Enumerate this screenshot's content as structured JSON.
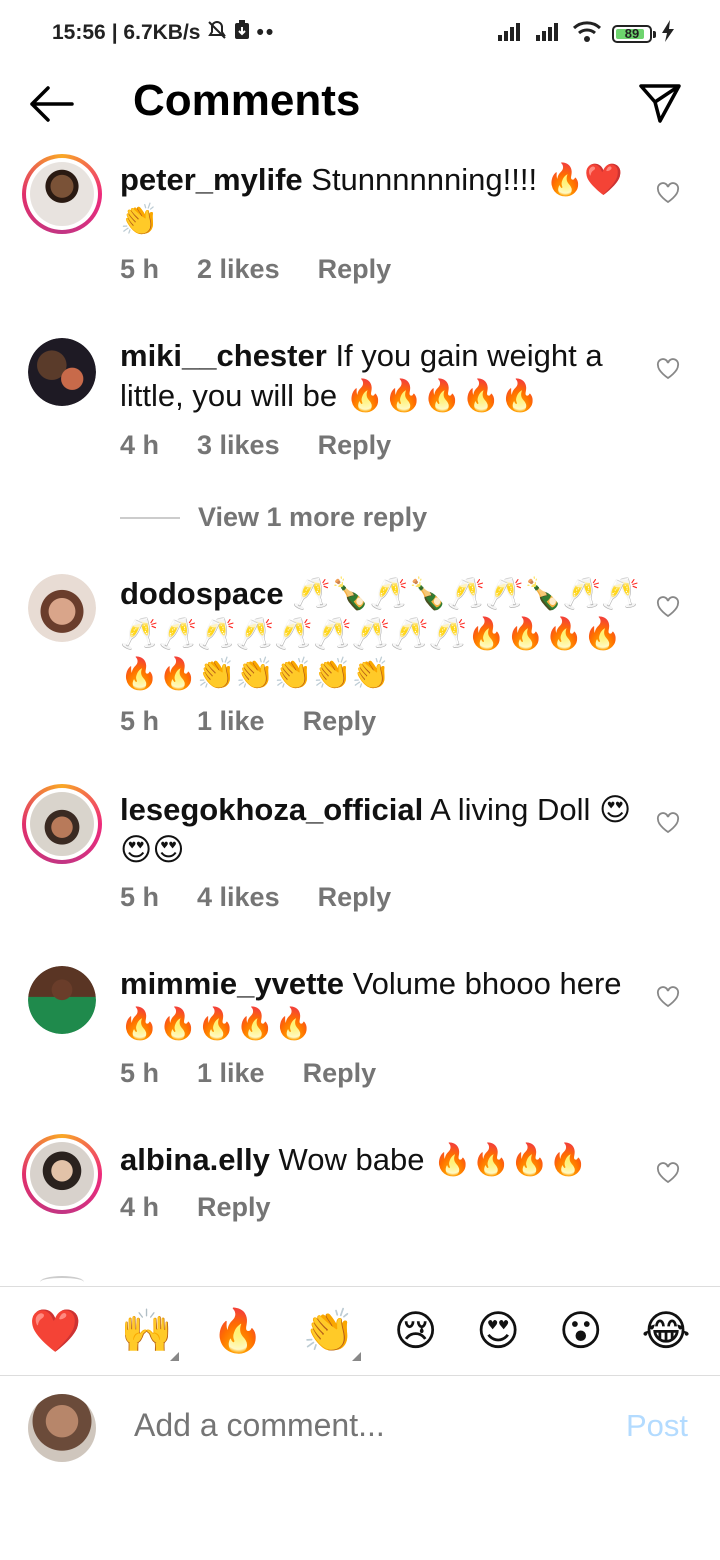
{
  "status_bar": {
    "time": "15:56",
    "speed": "| 6.7KB/s",
    "battery": "89"
  },
  "header": {
    "title": "Comments"
  },
  "comments": [
    {
      "user": "peter_mylife",
      "text": "Stunnnnnning!!!! 🔥❤️👏",
      "time": "5 h",
      "likes": "2 likes",
      "reply": "Reply"
    },
    {
      "user": "miki__chester",
      "text": "If you gain weight a little, you will be 🔥🔥🔥🔥🔥",
      "time": "4 h",
      "likes": "3 likes",
      "reply": "Reply"
    },
    {
      "user": "dodospace",
      "text": "🥂🍾🥂🍾🥂🥂🍾🥂🥂🥂🥂🥂🥂🥂🥂🥂🥂🥂🔥🔥🔥🔥🔥🔥👏👏👏👏👏",
      "time": "5 h",
      "likes": "1 like",
      "reply": "Reply"
    },
    {
      "user": "lesegokhoza_official",
      "text": "A living Doll 😍😍😍",
      "time": "5 h",
      "likes": "4 likes",
      "reply": "Reply"
    },
    {
      "user": "mimmie_yvette",
      "text": "Volume bhooo here🔥🔥🔥🔥🔥",
      "time": "5 h",
      "likes": "1 like",
      "reply": "Reply"
    },
    {
      "user": "albina.elly",
      "text": "Wow babe 🔥🔥🔥🔥",
      "time": "4 h",
      "reply": "Reply"
    }
  ],
  "view_more": "View 1 more reply",
  "emoji_bar": [
    "❤️",
    "🙌",
    "🔥",
    "👏",
    "😢",
    "😍",
    "😮",
    "😂"
  ],
  "composer": {
    "placeholder": "Add a comment...",
    "post": "Post"
  }
}
